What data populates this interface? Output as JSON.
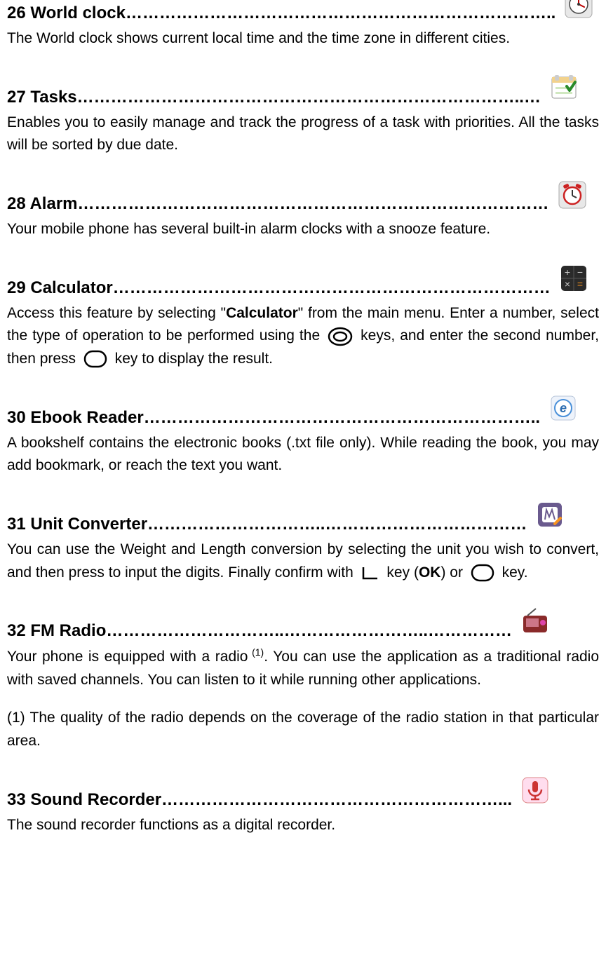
{
  "sections": {
    "s26": {
      "heading": "26 World clock…………………………………………………………………..",
      "body": "The World clock shows current local time and the time zone in different cities."
    },
    "s27": {
      "heading": "27 Tasks……………………………………………………………………..…",
      "body": "Enables you to easily manage and track the progress of a task with priorities. All the tasks will be sorted by due date."
    },
    "s28": {
      "heading": "28 Alarm…………………………………………………………………………",
      "body": "Your mobile phone has several built-in alarm clocks with a snooze feature."
    },
    "s29": {
      "heading": "29 Calculator……………………………………………………………………",
      "body_pre": "Access this feature by selecting \"",
      "body_strong": "Calculator",
      "body_mid1": "\" from the main menu. Enter a number, select the type of operation to be performed using the ",
      "body_mid2": " keys, and enter the second number, then press ",
      "body_post": " key to display the result."
    },
    "s30": {
      "heading": "30 Ebook Reader……………………………………………………………..",
      "body": "A bookshelf contains the electronic books (.txt file only). While reading the book, you may add bookmark, or reach the text you want."
    },
    "s31": {
      "heading": "31 Unit Converter…………………………..………………………………",
      "body_pre": "You can use the Weight and Length conversion by selecting the unit you wish to convert, and then press to input the digits. Finally confirm with ",
      "body_mid": " key (",
      "body_ok": "OK",
      "body_mid2": ") or ",
      "body_post": " key."
    },
    "s32": {
      "heading": "32 FM Radio…………………………..……………………..……………",
      "body_pre": "Your phone is equipped with a radio",
      "body_sup": " (1)",
      "body_post": ". You can use the application as a traditional radio with saved channels. You can listen to it while running other applications.",
      "footnote": "(1) The quality of the radio depends on the coverage of the radio station in that particular area."
    },
    "s33": {
      "heading": "33 Sound Recorder……………………………………………………...",
      "body": "The sound recorder functions as a digital recorder."
    }
  }
}
